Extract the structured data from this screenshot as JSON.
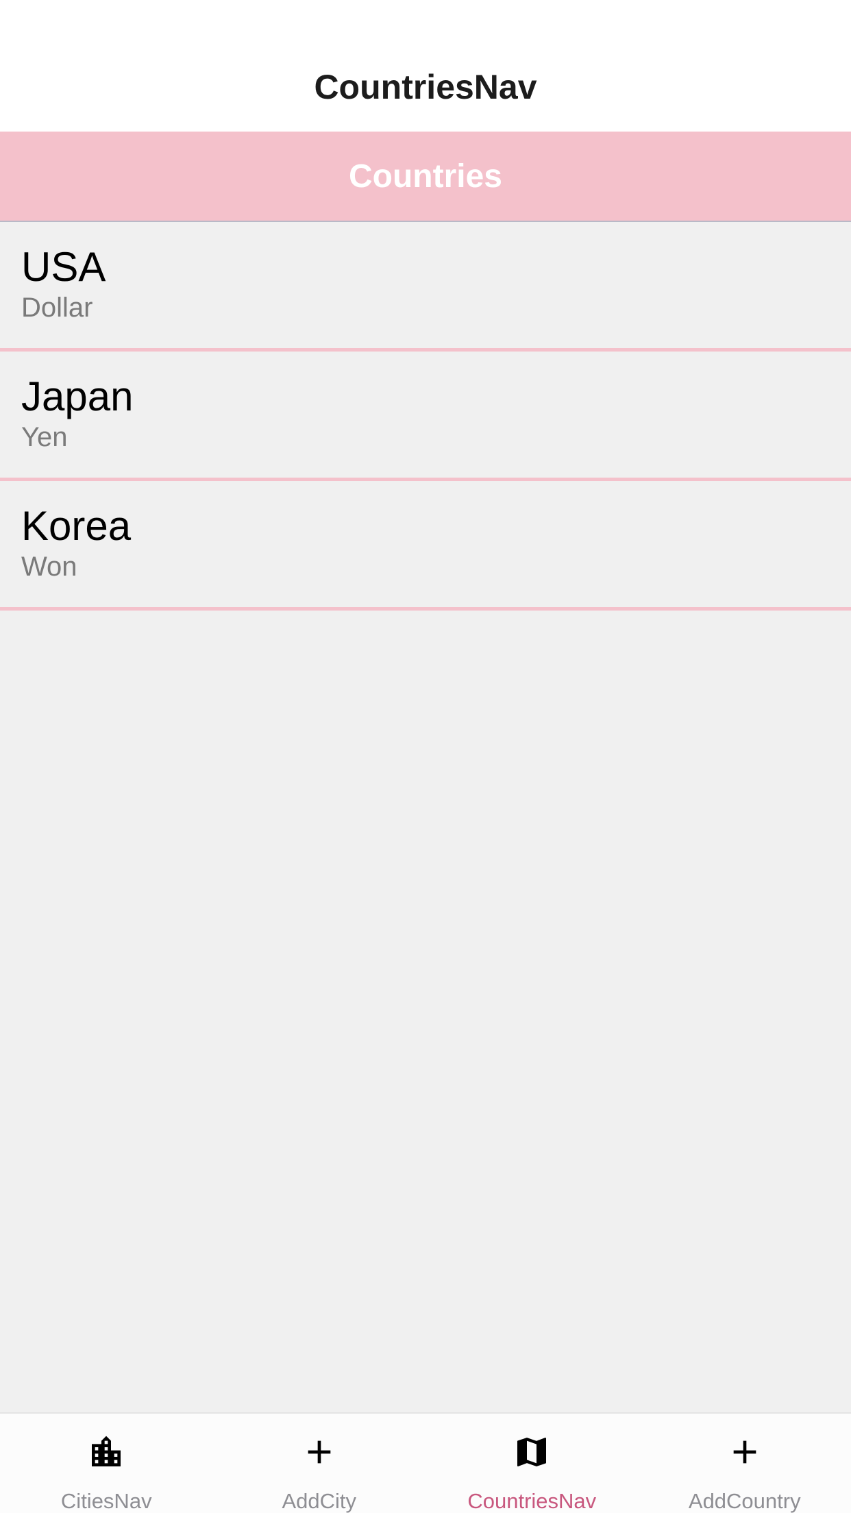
{
  "header": {
    "title": "CountriesNav"
  },
  "section": {
    "title": "Countries"
  },
  "countries": [
    {
      "name": "USA",
      "currency": "Dollar"
    },
    {
      "name": "Japan",
      "currency": "Yen"
    },
    {
      "name": "Korea",
      "currency": "Won"
    }
  ],
  "tabbar": {
    "tabs": [
      {
        "label": "CitiesNav",
        "icon": "city-icon",
        "active": false
      },
      {
        "label": "AddCity",
        "icon": "plus-icon",
        "active": false
      },
      {
        "label": "CountriesNav",
        "icon": "map-icon",
        "active": true
      },
      {
        "label": "AddCountry",
        "icon": "plus-icon",
        "active": false
      }
    ]
  },
  "colors": {
    "accent": "#c8577e",
    "section_background": "#f4c1cb",
    "list_background": "#f0f0f0"
  }
}
